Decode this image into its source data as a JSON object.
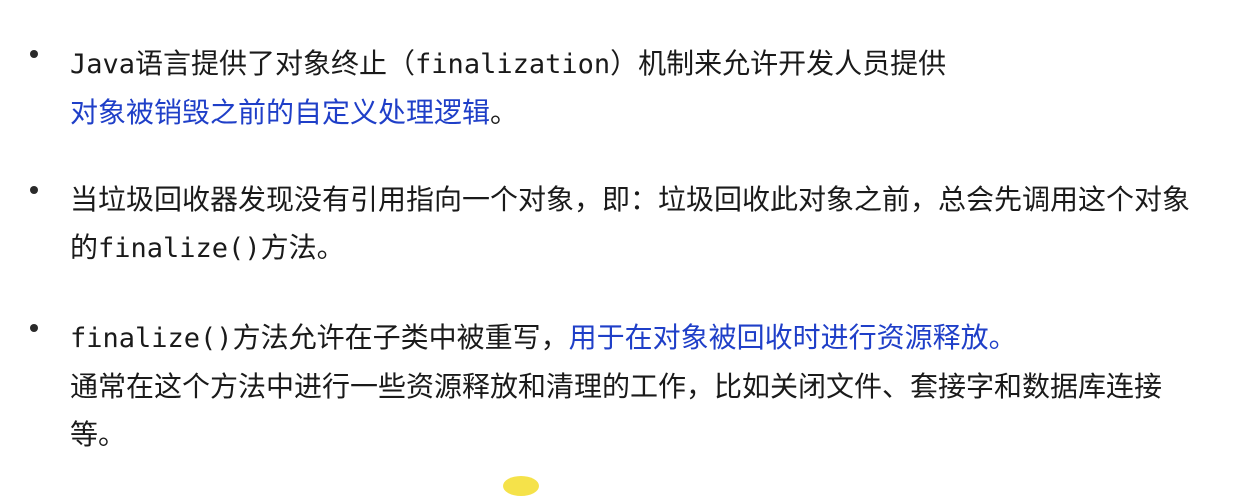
{
  "bullets": [
    {
      "segments": [
        {
          "text": "Java",
          "style": "mono"
        },
        {
          "text": "语言提供了对象终止（",
          "style": "normal"
        },
        {
          "text": "finalization",
          "style": "mono"
        },
        {
          "text": "）机制来允许开发人员提供",
          "style": "normal"
        },
        {
          "text": "对象被销毁之前的自定义处理逻辑",
          "style": "highlight"
        },
        {
          "text": "。",
          "style": "normal"
        }
      ]
    },
    {
      "segments": [
        {
          "text": "当垃圾回收器发现没有引用指向一个对象，即：垃圾回收此对象之前，总会先调用这个对象的",
          "style": "normal"
        },
        {
          "text": "finalize()",
          "style": "mono"
        },
        {
          "text": "方法。",
          "style": "normal"
        }
      ]
    },
    {
      "segments": [
        {
          "text": "finalize()",
          "style": "mono"
        },
        {
          "text": "方法允许在子类中被重写，",
          "style": "normal"
        },
        {
          "text": "用于在对象被回收时进行资源释放。",
          "style": "highlight"
        },
        {
          "text": "通常在这个方法中进行一些资源释放和清理的工作，比如关闭文件、套接字和数据库连接等。",
          "style": "normal"
        }
      ]
    }
  ],
  "colors": {
    "text": "#1a1a1a",
    "highlight": "#1f3fc8",
    "cursor": "#f5e24a"
  }
}
